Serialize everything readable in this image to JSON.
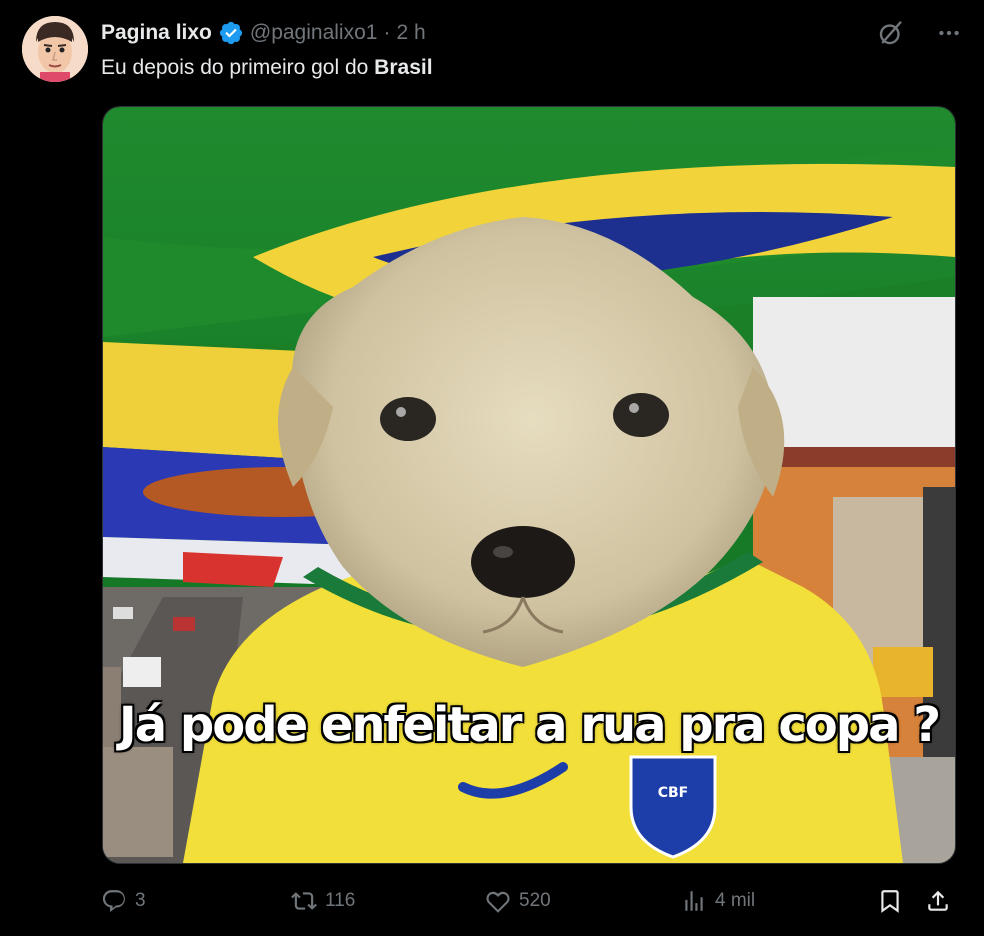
{
  "tweet": {
    "author_name": "Pagina lixo",
    "handle": "@paginalixo1",
    "separator": "·",
    "time": "2 h",
    "text_prefix": "Eu depois do primeiro gol do ",
    "text_bold": "Brasil"
  },
  "icons": {
    "verified": "verified-badge-icon",
    "grok": "grok-icon",
    "more": "more-options-icon",
    "reply": "reply-icon",
    "retweet": "retweet-icon",
    "like": "heart-icon",
    "views": "views-chart-icon",
    "bookmark": "bookmark-icon",
    "share": "share-icon"
  },
  "media": {
    "caption": "Já pode enfeitar a rua pra copa ?",
    "badge_text": "CBF"
  },
  "stats": {
    "replies": "3",
    "retweets": "116",
    "likes": "520",
    "views": "4 mil"
  },
  "colors": {
    "background": "#000000",
    "text_primary": "#e7e9ea",
    "text_secondary": "#71767b",
    "verified_blue": "#1d9bf0",
    "brazil_green": "#1e8a2b",
    "brazil_yellow": "#f2d43a",
    "brazil_blue": "#1d2f8f"
  }
}
